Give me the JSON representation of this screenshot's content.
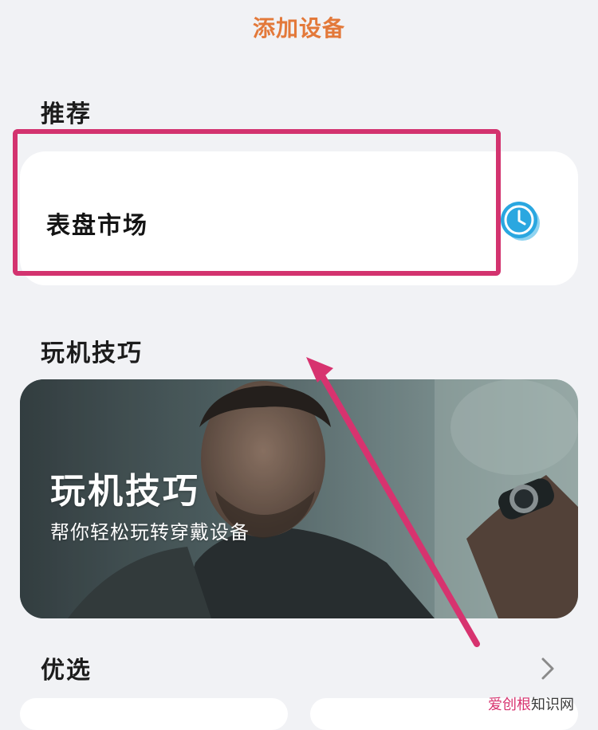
{
  "header": {
    "title": "添加设备"
  },
  "recommend": {
    "title": "推荐",
    "card_label": "表盘市场",
    "card_icon": "clock-icon"
  },
  "tips": {
    "title": "玩机技巧",
    "banner_title": "玩机技巧",
    "banner_subtitle": "帮你轻松玩转穿戴设备"
  },
  "featured": {
    "title": "优选",
    "more_icon": "chevron-right-icon"
  },
  "overlay": {
    "highlight_color": "#d3336f",
    "arrow_color": "#d7336f"
  },
  "watermark": {
    "part1": "爱创根",
    "part2": "知识网"
  },
  "colors": {
    "accent": "#e3793a",
    "background": "#f1f2f5",
    "icon_blue": "#2aa7e0"
  }
}
